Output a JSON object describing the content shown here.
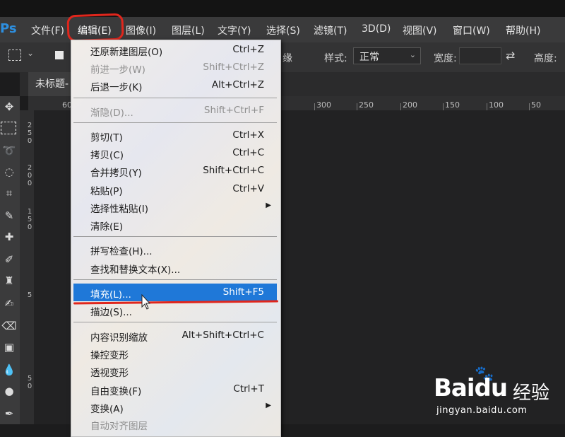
{
  "app": {
    "logo": "Ps"
  },
  "menubar": {
    "items": [
      {
        "label": "文件(F)"
      },
      {
        "label": "编辑(E)"
      },
      {
        "label": "图像(I)"
      },
      {
        "label": "图层(L)"
      },
      {
        "label": "文字(Y)"
      },
      {
        "label": "选择(S)"
      },
      {
        "label": "滤镜(T)"
      },
      {
        "label": "3D(D)"
      },
      {
        "label": "视图(V)"
      },
      {
        "label": "窗口(W)"
      },
      {
        "label": "帮助(H)"
      }
    ],
    "active": "编辑(E)"
  },
  "options": {
    "partial_label": "调整边缘",
    "partial_visible": "缘",
    "style_label": "样式:",
    "style_value": "正常",
    "width_label": "宽度:",
    "height_label": "高度:"
  },
  "document": {
    "tab_title": "未标题-"
  },
  "ruler": {
    "h_labels": [
      "60",
      "300",
      "250",
      "200",
      "150",
      "100",
      "50"
    ],
    "v_labels": [
      [
        "2",
        "5",
        "0"
      ],
      [
        "2",
        "0",
        "0"
      ],
      [
        "1",
        "5",
        "0"
      ],
      [
        "5"
      ],
      [
        "5",
        "0"
      ]
    ]
  },
  "edit_menu": {
    "items": [
      {
        "label": "还原新建图层(O)",
        "shortcut": "Ctrl+Z",
        "disabled": false
      },
      {
        "label": "前进一步(W)",
        "shortcut": "Shift+Ctrl+Z",
        "disabled": true
      },
      {
        "label": "后退一步(K)",
        "shortcut": "Alt+Ctrl+Z",
        "disabled": false
      },
      {
        "label": "渐隐(D)...",
        "shortcut": "Shift+Ctrl+F",
        "disabled": true
      },
      {
        "label": "剪切(T)",
        "shortcut": "Ctrl+X",
        "disabled": false
      },
      {
        "label": "拷贝(C)",
        "shortcut": "Ctrl+C",
        "disabled": false
      },
      {
        "label": "合并拷贝(Y)",
        "shortcut": "Shift+Ctrl+C",
        "disabled": false
      },
      {
        "label": "粘贴(P)",
        "shortcut": "Ctrl+V",
        "disabled": false
      },
      {
        "label": "选择性粘贴(I)",
        "shortcut": "",
        "disabled": false,
        "submenu": true
      },
      {
        "label": "清除(E)",
        "shortcut": "",
        "disabled": false
      },
      {
        "label": "拼写检查(H)...",
        "shortcut": "",
        "disabled": false
      },
      {
        "label": "查找和替换文本(X)...",
        "shortcut": "",
        "disabled": false
      },
      {
        "label": "填充(L)...",
        "shortcut": "Shift+F5",
        "disabled": false,
        "highlighted": true
      },
      {
        "label": "描边(S)...",
        "shortcut": "",
        "disabled": false
      },
      {
        "label": "内容识别缩放",
        "shortcut": "Alt+Shift+Ctrl+C",
        "disabled": false
      },
      {
        "label": "操控变形",
        "shortcut": "",
        "disabled": false
      },
      {
        "label": "透视变形",
        "shortcut": "",
        "disabled": false
      },
      {
        "label": "自由变换(F)",
        "shortcut": "Ctrl+T",
        "disabled": false
      },
      {
        "label": "变换(A)",
        "shortcut": "",
        "disabled": false,
        "submenu": true
      },
      {
        "label": "自动对齐图层",
        "shortcut": "",
        "disabled": true
      }
    ]
  },
  "watermark": {
    "brand": "Bai",
    "brand_suffix": "du",
    "brand_cn": "经验",
    "url": "jingyan.baidu.com"
  },
  "colors": {
    "highlight": "#1f78d8",
    "annotation_red": "#e0261c",
    "ps_blue": "#2d8fe0"
  }
}
